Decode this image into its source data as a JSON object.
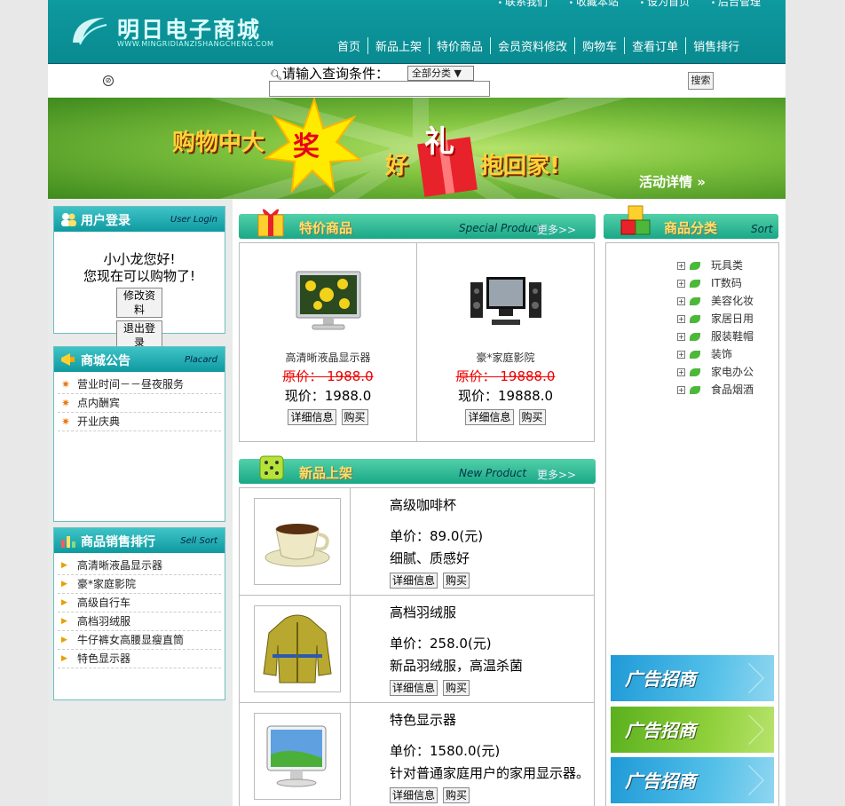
{
  "header": {
    "logo_text": "明日电子商城",
    "logo_sub": "WWW.MINGRIDIANZISHANGCHENG.COM",
    "top_links": [
      "联系我们",
      "收藏本站",
      "设为首页",
      "后台管理"
    ],
    "nav": [
      "首页",
      "新品上架",
      "特价商品",
      "会员资料修改",
      "购物车",
      "查看订单",
      "销售排行"
    ]
  },
  "search": {
    "label": "请输入查询条件：",
    "category": "全部分类",
    "button": "搜索",
    "value": ""
  },
  "banner": {
    "text1": "购物中大",
    "text1_star": "奖",
    "text2": "好",
    "text2_box": "礼",
    "text3": "抱回家!",
    "details": "活动详情 »"
  },
  "login": {
    "title": "用户登录",
    "title_en": "User Login",
    "greeting": "小小龙您好!",
    "message": "您现在可以购物了!",
    "edit_btn": "修改资料",
    "logout_btn": "退出登录"
  },
  "placard": {
    "title": "商城公告",
    "title_en": "Placard",
    "items": [
      "营业时间－－昼夜服务",
      "点内酬宾",
      "开业庆典"
    ]
  },
  "sell": {
    "title": "商品销售排行",
    "title_en": "Sell Sort",
    "items": [
      "高清晰液晶显示器",
      "豪*家庭影院",
      "高级自行车",
      "高档羽绒服",
      "牛仔裤女高腰显瘦直筒",
      "特色显示器"
    ]
  },
  "special": {
    "title": "特价商品",
    "title_en": "Special Product",
    "more": "更多>>",
    "products": [
      {
        "name": "高清晰液晶显示器",
        "original": "原价：  1988.0",
        "current": "现价：1988.0",
        "detail_btn": "详细信息",
        "buy_btn": "购买"
      },
      {
        "name": "豪*家庭影院",
        "original": "原价：  19888.0",
        "current": "现价：19888.0",
        "detail_btn": "详细信息",
        "buy_btn": "购买"
      }
    ]
  },
  "newp": {
    "title": "新品上架",
    "title_en": "New Product",
    "more": "更多>>",
    "products": [
      {
        "name": "高级咖啡杯",
        "price": "单价：89.0(元)",
        "desc": "细腻、质感好",
        "detail_btn": "详细信息",
        "buy_btn": "购买"
      },
      {
        "name": "高档羽绒服",
        "price": "单价：258.0(元)",
        "desc": "新品羽绒服，高温杀菌",
        "detail_btn": "详细信息",
        "buy_btn": "购买"
      },
      {
        "name": "特色显示器",
        "price": "单价：1580.0(元)",
        "desc": "针对普通家庭用户的家用显示器。",
        "detail_btn": "详细信息",
        "buy_btn": "购买"
      }
    ]
  },
  "sort": {
    "title": "商品分类",
    "title_en": "Sort",
    "categories": [
      "玩具类",
      "IT数码",
      "美容化妆",
      "家居日用",
      "服装鞋帽",
      "装饰",
      "家电办公",
      "食品烟酒"
    ]
  },
  "ads": [
    "广告招商",
    "广告招商",
    "广告招商"
  ],
  "colors": {
    "header": "#0e9aa0",
    "accent": "#1aa887",
    "price_old": "#e00000"
  }
}
